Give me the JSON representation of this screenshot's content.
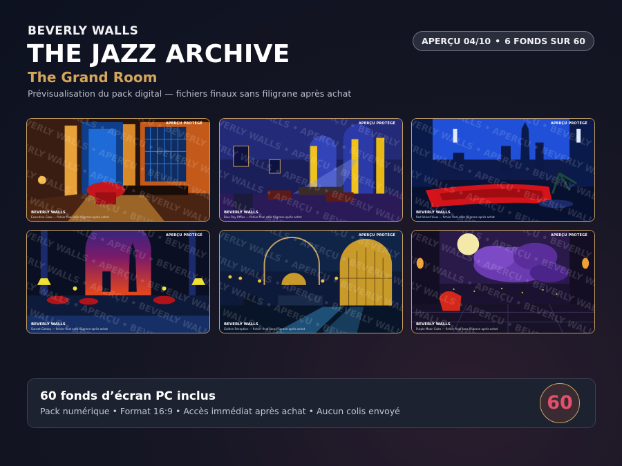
{
  "header": {
    "brand": "BEVERLY WALLS",
    "title": "THE JAZZ ARCHIVE",
    "subtitle": "The Grand Room",
    "description": "Prévisualisation du pack digital — fichiers finaux sans filigrane après achat"
  },
  "pill": {
    "preview": "APERÇU 04/10",
    "separator": "•",
    "count": "6 FONDS SUR 60"
  },
  "cards": [
    {
      "tag": "APERÇU PROTÉGÉ",
      "brand": "BEVERLY WALLS",
      "caption": "Executive Glow — fichier final sans filigrane après achat"
    },
    {
      "tag": "APERÇU PROTÉGÉ",
      "brand": "BEVERLY WALLS",
      "caption": "Blue Ray Office — fichier final sans filigrane après achat"
    },
    {
      "tag": "APERÇU PROTÉGÉ",
      "brand": "BEVERLY WALLS",
      "caption": "Red Velvet View — fichier final sans filigrane après achat"
    },
    {
      "tag": "APERÇU PROTÉGÉ",
      "brand": "BEVERLY WALLS",
      "caption": "Sunset Gatsby — fichier final sans filigrane après achat"
    },
    {
      "tag": "APERÇU PROTÉGÉ",
      "brand": "BEVERLY WALLS",
      "caption": "Golden Reception — fichier final sans filigrane après achat"
    },
    {
      "tag": "APERÇU PROTÉGÉ",
      "brand": "BEVERLY WALLS",
      "caption": "Purple Moon Suite — fichier final sans filigrane après achat"
    }
  ],
  "watermark": "BEVERLY WALLS • APERÇU • BEVERLY WALLS • APERÇU •",
  "banner": {
    "title": "60 fonds d’écran PC inclus",
    "details": "Pack numérique • Format 16:9 • Accès immédiat après achat • Aucun colis envoyé",
    "badge": "60"
  },
  "colors": {
    "accent_gold": "#c9a262",
    "badge_red": "#e2506b",
    "subtitle_gold": "#d4a55c"
  }
}
